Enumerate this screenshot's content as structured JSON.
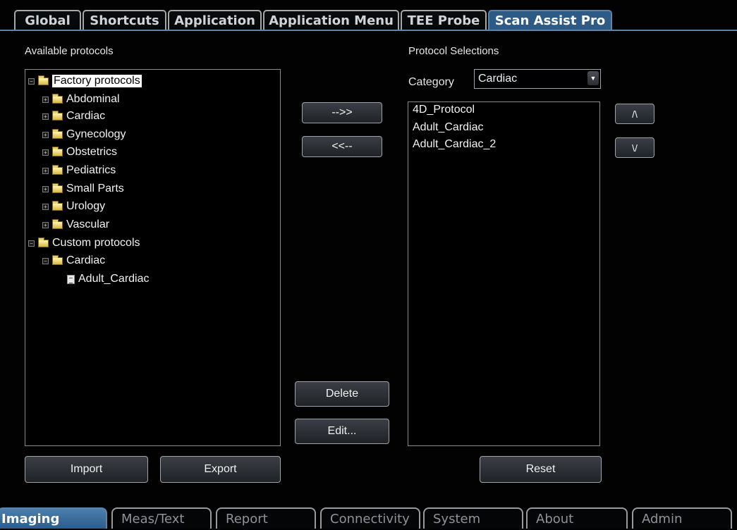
{
  "top_tabs": [
    "Global",
    "Shortcuts",
    "Application",
    "Application Menu",
    "TEE Probe",
    "Scan Assist Pro"
  ],
  "active_top_tab": "Scan Assist Pro",
  "available": {
    "label": "Available protocols",
    "tree": {
      "factory_root": "Factory protocols",
      "factory_children": [
        "Abdominal",
        "Cardiac",
        "Gynecology",
        "Obstetrics",
        "Pediatrics",
        "Small Parts",
        "Urology",
        "Vascular"
      ],
      "custom_root": "Custom protocols",
      "custom_folder": "Cardiac",
      "custom_item": "Adult_Cardiac"
    }
  },
  "middle_buttons": {
    "add": "-->>",
    "remove": "<<--",
    "delete": "Delete",
    "edit": "Edit..."
  },
  "selections": {
    "label": "Protocol Selections",
    "category_label": "Category",
    "category_value": "Cardiac",
    "items": [
      "4D_Protocol",
      "Adult_Cardiac",
      "Adult_Cardiac_2"
    ],
    "up": "/\\",
    "down": "\\/"
  },
  "bottom_buttons": {
    "import": "Import",
    "export": "Export",
    "reset": "Reset"
  },
  "bottom_tabs": [
    "Imaging",
    "Meas/Text",
    "Report",
    "Connectivity",
    "System",
    "About",
    "Admin"
  ],
  "active_bottom_tab": "Imaging"
}
